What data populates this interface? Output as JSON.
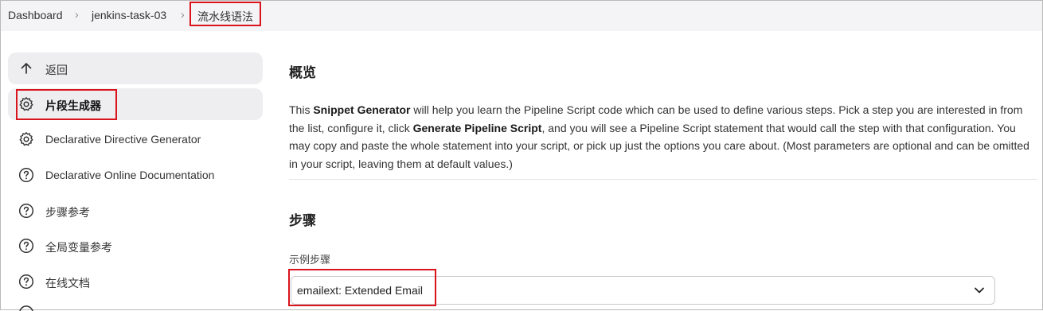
{
  "breadcrumb": {
    "items": [
      "Dashboard",
      "jenkins-task-03",
      "流水线语法"
    ]
  },
  "sidebar": {
    "items": [
      {
        "label": "返回",
        "icon": "arrow-up-icon"
      },
      {
        "label": "片段生成器",
        "icon": "gear-icon",
        "active": true
      },
      {
        "label": "Declarative Directive Generator",
        "icon": "gear-icon"
      },
      {
        "label": "Declarative Online Documentation",
        "icon": "help-circle-icon"
      },
      {
        "label": "步骤参考",
        "icon": "help-circle-icon"
      },
      {
        "label": "全局变量参考",
        "icon": "help-circle-icon"
      },
      {
        "label": "在线文档",
        "icon": "help-circle-icon"
      }
    ]
  },
  "main": {
    "overview_title": "概览",
    "intro": {
      "p1": "This ",
      "b1": "Snippet Generator",
      "p2": " will help you learn the Pipeline Script code which can be used to define various steps. Pick a step you are interested in from the list, configure it, click ",
      "b2": "Generate Pipeline Script",
      "p3": ", and you will see a Pipeline Script statement that would call the step with that configuration. You may copy and paste the whole statement into your script, or pick up just the options you care about. (Most parameters are optional and can be omitted in your script, leaving them at default values.)"
    },
    "steps_title": "步骤",
    "sample_step_label": "示例步骤",
    "sample_step_value": "emailext: Extended Email"
  },
  "colors": {
    "highlight_box": "#d9141c",
    "active_item_bg": "#eeeef1",
    "breadcrumb_bg": "#f4f4f6"
  }
}
